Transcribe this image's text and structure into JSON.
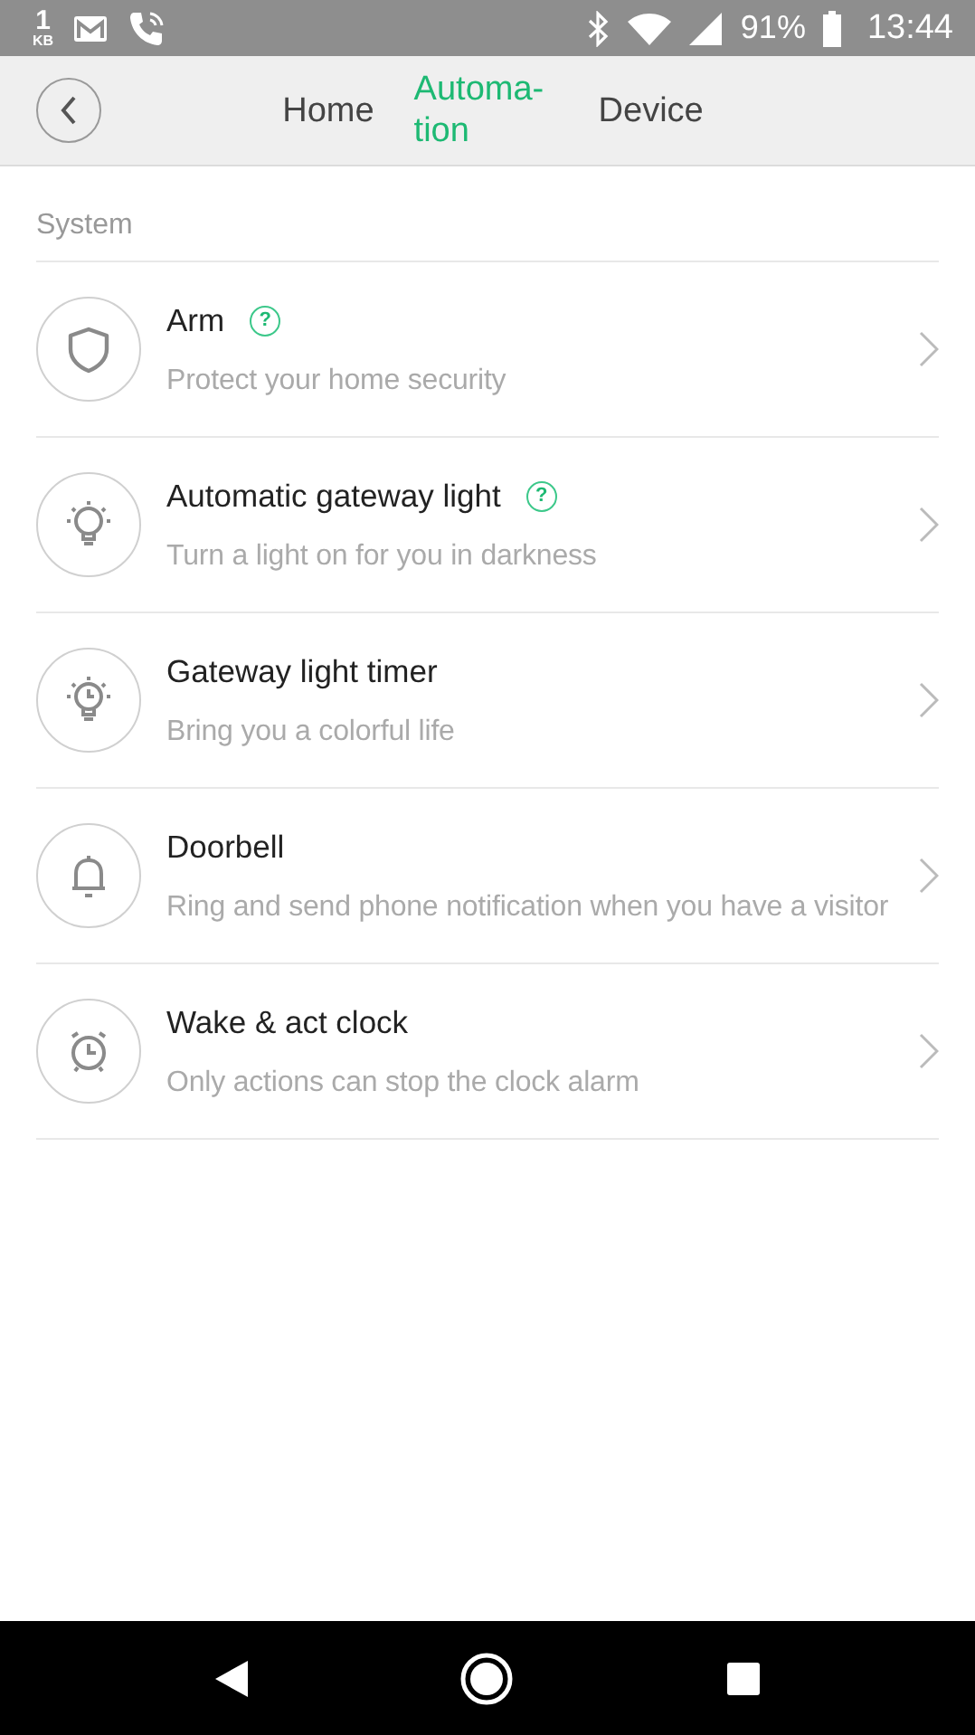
{
  "status_bar": {
    "data_speed": "1",
    "data_unit": "KB",
    "battery": "91%",
    "time": "13:44"
  },
  "tabs": [
    {
      "label": "Home",
      "selected": false
    },
    {
      "label": "Automa-tion",
      "selected": true
    },
    {
      "label": "Device",
      "selected": false
    }
  ],
  "section": "System",
  "items": [
    {
      "title": "Arm",
      "badge": "?",
      "subtitle": "Protect your home security"
    },
    {
      "title": "Automatic gateway light",
      "badge": "?",
      "subtitle": "Turn a light on for you in darkness"
    },
    {
      "title": "Gateway light timer",
      "subtitle": "Bring you a colorful life"
    },
    {
      "title": "Doorbell",
      "subtitle": "Ring and send phone notification when you have a visitor"
    },
    {
      "title": "Wake & act clock",
      "subtitle": "Only actions can stop the clock alarm"
    }
  ]
}
